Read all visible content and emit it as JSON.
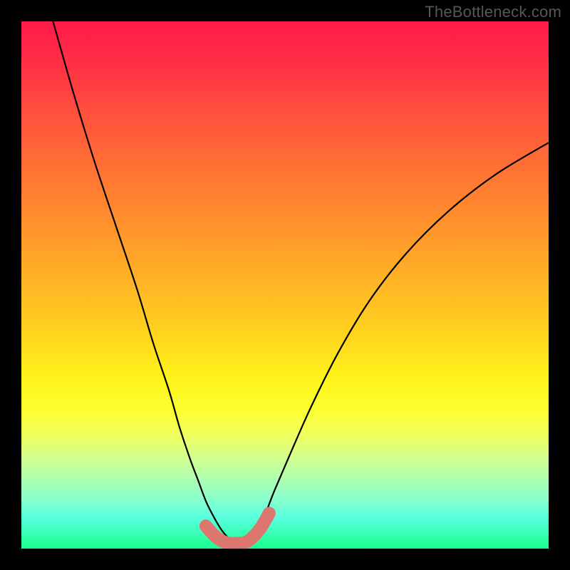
{
  "watermark": "TheBottleneck.com",
  "colors": {
    "page_bg": "#000000",
    "curve_stroke": "#000000",
    "marker": "#dd766f",
    "gradient_top": "#ff1a4b",
    "gradient_bottom": "#1aff8e"
  },
  "chart_data": {
    "type": "line",
    "title": "",
    "xlabel": "",
    "ylabel": "",
    "xlim": [
      0,
      100
    ],
    "ylim": [
      0,
      100
    ],
    "series": [
      {
        "name": "left-branch",
        "x": [
          6,
          10,
          14,
          18,
          22,
          25,
          28,
          30,
          32,
          33.5,
          35,
          36.5,
          38,
          39.5,
          41
        ],
        "y": [
          100,
          86,
          73,
          61,
          49,
          39,
          30,
          23,
          17,
          13,
          9,
          6,
          3.5,
          1.8,
          0.8
        ]
      },
      {
        "name": "right-branch",
        "x": [
          42,
          44,
          46,
          48,
          51,
          55,
          60,
          66,
          73,
          81,
          90,
          100
        ],
        "y": [
          0.8,
          2.5,
          6,
          11,
          18,
          27,
          37,
          47,
          56,
          64,
          71,
          77
        ]
      }
    ],
    "markers": {
      "name": "bottom-marker",
      "x": [
        35.0,
        36.5,
        38.0,
        39.5,
        41.0,
        42.5,
        44.0,
        45.5,
        47.0
      ],
      "y": [
        4.3,
        2.6,
        1.5,
        1.0,
        1.0,
        1.2,
        2.3,
        4.1,
        6.7
      ]
    },
    "left_end_dot": {
      "x": 35.0,
      "y": 4.3
    },
    "right_end_dot": {
      "x": 47.0,
      "y": 6.7
    }
  }
}
